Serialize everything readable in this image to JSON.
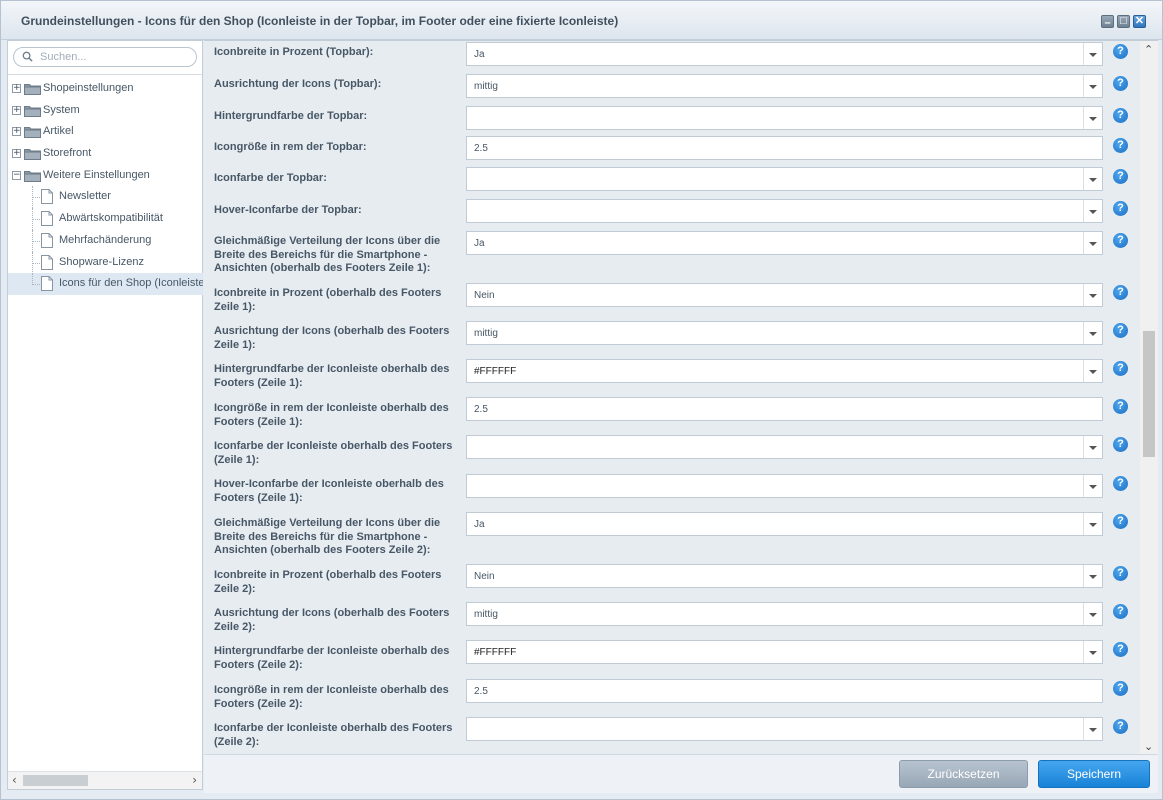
{
  "window": {
    "title": "Grundeinstellungen - Icons für den Shop (Iconleiste in der Topbar, im Footer oder eine fixierte Iconleiste)",
    "minimize_symbol": "–",
    "maximize_symbol": "□",
    "close_symbol": "✕"
  },
  "search": {
    "placeholder": "Suchen..."
  },
  "tree": {
    "folders": [
      {
        "label": "Shopeinstellungen",
        "expander": "+"
      },
      {
        "label": "System",
        "expander": "+"
      },
      {
        "label": "Artikel",
        "expander": "+"
      },
      {
        "label": "Storefront",
        "expander": "+"
      },
      {
        "label": "Weitere Einstellungen",
        "expander": "−"
      }
    ],
    "children": [
      {
        "label": "Newsletter"
      },
      {
        "label": "Abwärtskompatibilität"
      },
      {
        "label": "Mehrfachänderung"
      },
      {
        "label": "Shopware-Lizenz"
      },
      {
        "label": "Icons für den Shop (Iconleiste"
      }
    ]
  },
  "form": {
    "rows": [
      {
        "label": "Iconbreite in Prozent (Topbar):",
        "value": "Ja",
        "type": "select"
      },
      {
        "label": "Ausrichtung der Icons (Topbar):",
        "value": "mittig",
        "type": "select"
      },
      {
        "label": "Hintergrundfarbe der Topbar:",
        "value": "",
        "type": "select"
      },
      {
        "label": "Icongröße in rem der Topbar:",
        "value": "2.5",
        "type": "text"
      },
      {
        "label": "Iconfarbe der Topbar:",
        "value": "",
        "type": "select"
      },
      {
        "label": "Hover-Iconfarbe der Topbar:",
        "value": "",
        "type": "select"
      },
      {
        "label": "Gleichmäßige Verteilung der Icons über die Breite des Bereichs für die Smartphone - Ansichten (oberhalb des Footers Zeile 1):",
        "value": "Ja",
        "type": "select"
      },
      {
        "label": "Iconbreite in Prozent (oberhalb des Footers Zeile 1):",
        "value": "Nein",
        "type": "select"
      },
      {
        "label": "Ausrichtung der Icons (oberhalb des Footers Zeile 1):",
        "value": "mittig",
        "type": "select"
      },
      {
        "label": "Hintergrundfarbe der Iconleiste oberhalb des Footers (Zeile 1):",
        "value": "#FFFFFF",
        "type": "select"
      },
      {
        "label": "Icongröße in rem der Iconleiste oberhalb des Footers (Zeile 1):",
        "value": "2.5",
        "type": "text"
      },
      {
        "label": "Iconfarbe der Iconleiste oberhalb des Footers (Zeile 1):",
        "value": "",
        "type": "select"
      },
      {
        "label": "Hover-Iconfarbe der Iconleiste oberhalb des Footers (Zeile 1):",
        "value": "",
        "type": "select"
      },
      {
        "label": "Gleichmäßige Verteilung der Icons über die Breite des Bereichs für die Smartphone - Ansichten (oberhalb des Footers Zeile 2):",
        "value": "Ja",
        "type": "select"
      },
      {
        "label": "Iconbreite in Prozent (oberhalb des Footers Zeile 2):",
        "value": "Nein",
        "type": "select"
      },
      {
        "label": "Ausrichtung der Icons (oberhalb des Footers Zeile 2):",
        "value": "mittig",
        "type": "select"
      },
      {
        "label": "Hintergrundfarbe der Iconleiste oberhalb des Footers (Zeile 2):",
        "value": "#FFFFFF",
        "type": "select"
      },
      {
        "label": "Icongröße in rem der Iconleiste oberhalb des Footers (Zeile 2):",
        "value": "2.5",
        "type": "text"
      },
      {
        "label": "Iconfarbe der Iconleiste oberhalb des Footers (Zeile 2):",
        "value": "",
        "type": "select"
      }
    ],
    "help_symbol": "?"
  },
  "scroll": {
    "up": "⌃",
    "down": "⌄",
    "left": "‹",
    "right": "›"
  },
  "buttons": {
    "reset_label": "Zurücksetzen",
    "save_label": "Speichern"
  },
  "colors": {
    "accent": "#1882d7",
    "help": "#1b6fc2",
    "reset": "#a8b5c2"
  }
}
